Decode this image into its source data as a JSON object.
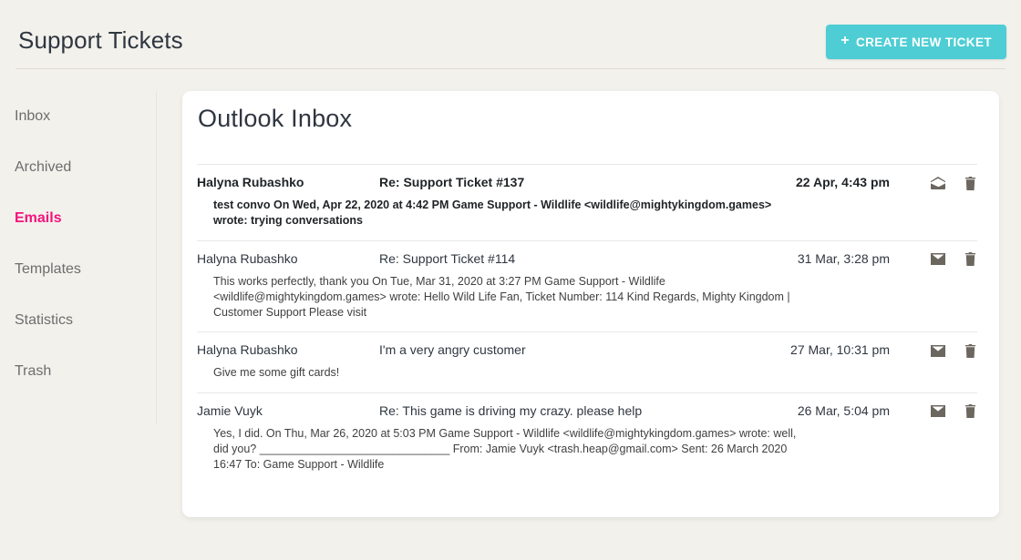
{
  "header": {
    "title": "Support Tickets",
    "create_button_label": "CREATE NEW TICKET",
    "create_button_icon": "plus-icon",
    "accent_color": "#4ecdd4"
  },
  "sidebar": {
    "active_color": "#f5127c",
    "items": [
      {
        "label": "Inbox",
        "active": false
      },
      {
        "label": "Archived",
        "active": false
      },
      {
        "label": "Emails",
        "active": true
      },
      {
        "label": "Templates",
        "active": false
      },
      {
        "label": "Statistics",
        "active": false
      },
      {
        "label": "Trash",
        "active": false
      }
    ]
  },
  "main": {
    "card_title": "Outlook Inbox",
    "emails": [
      {
        "sender": "Halyna Rubashko",
        "subject": "Re: Support Ticket #137",
        "date": "22 Apr, 4:43 pm",
        "snippet": "test convo On Wed, Apr 22, 2020 at 4:42 PM Game Support - Wildlife <wildlife@mightykingdom.games> wrote: trying conversations",
        "unread": true,
        "mail_icon": "envelope-open-icon",
        "delete_icon": "trash-icon"
      },
      {
        "sender": "Halyna Rubashko",
        "subject": "Re: Support Ticket #114",
        "date": "31 Mar, 3:28 pm",
        "snippet": "This works perfectly, thank you On Tue, Mar 31, 2020 at 3:27 PM Game Support - Wildlife <wildlife@mightykingdom.games> wrote: Hello Wild Life Fan, Ticket Number: 114 Kind Regards, Mighty Kingdom | Customer Support Please visit",
        "unread": false,
        "mail_icon": "envelope-closed-icon",
        "delete_icon": "trash-icon"
      },
      {
        "sender": "Halyna Rubashko",
        "subject": "I'm a very angry customer",
        "date": "27 Mar, 10:31 pm",
        "snippet": "Give me some gift cards!",
        "unread": false,
        "mail_icon": "envelope-closed-icon",
        "delete_icon": "trash-icon"
      },
      {
        "sender": "Jamie Vuyk",
        "subject": "Re: This game is driving my crazy. please help",
        "date": "26 Mar, 5:04 pm",
        "snippet": "Yes, I did. On Thu, Mar 26, 2020 at 5:03 PM Game Support - Wildlife <wildlife@mightykingdom.games> wrote: well, did you? ______________________________ From: Jamie Vuyk <trash.heap@gmail.com> Sent: 26 March 2020 16:47 To: Game Support - Wildlife",
        "unread": false,
        "mail_icon": "envelope-closed-icon",
        "delete_icon": "trash-icon"
      }
    ]
  }
}
